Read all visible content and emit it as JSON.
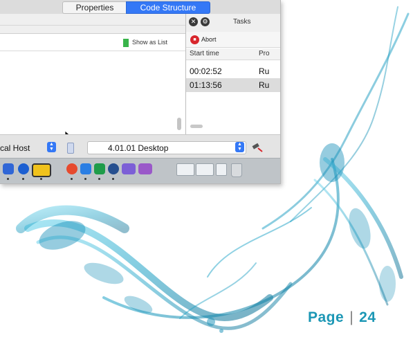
{
  "tabs": [
    {
      "label": "Properties",
      "selected": false
    },
    {
      "label": "Code Structure",
      "selected": true
    }
  ],
  "left_panel": {
    "show_as_list_label": "Show as List"
  },
  "tasks_panel": {
    "title": "Tasks",
    "abort_label": "Abort",
    "columns": [
      "Start time",
      "Pro"
    ],
    "rows": [
      {
        "start_time": "00:02:52",
        "status": "Ru"
      },
      {
        "start_time": "01:13:56",
        "status": "Ru"
      }
    ]
  },
  "bottom_bar": {
    "host_label": "cal Host",
    "desktop_label": "4.01.01 Desktop"
  },
  "page": {
    "label": "Page",
    "separator": "|",
    "number": "24"
  },
  "colors": {
    "accent": "#3478f6",
    "page_label": "#1c97b5",
    "abort": "#d8262c",
    "show_as_list_swatch": "#39b44a"
  },
  "icons": [
    "close-icon",
    "settings-icon",
    "abort-icon",
    "stepper-icon",
    "device-icon",
    "tool-icon",
    "pointer-cursor-icon"
  ]
}
